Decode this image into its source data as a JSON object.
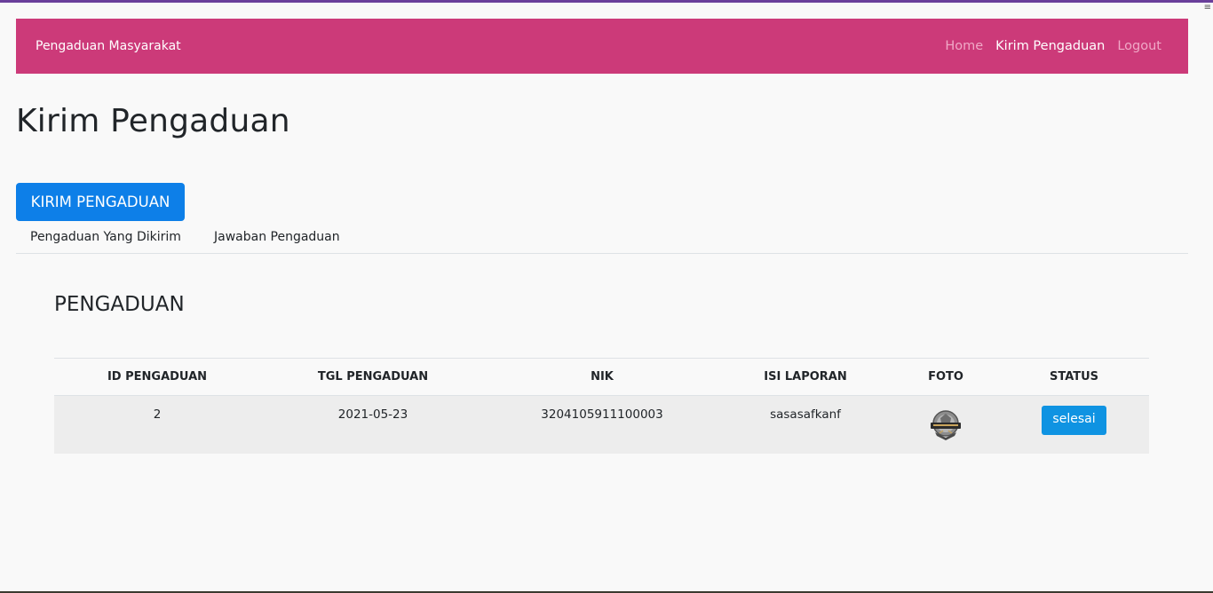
{
  "navbar": {
    "brand": "Pengaduan Masyarakat",
    "links": [
      {
        "label": "Home",
        "active": false
      },
      {
        "label": "Kirim Pengaduan",
        "active": true
      },
      {
        "label": "Logout",
        "active": false
      }
    ]
  },
  "page": {
    "title": "Kirim Pengaduan",
    "button_label": "KIRIM PENGADUAN",
    "tabs": [
      "Pengaduan Yang Dikirim",
      "Jawaban Pengaduan"
    ]
  },
  "section": {
    "title": "PENGADUAN"
  },
  "table": {
    "headers": [
      "ID PENGADUAN",
      "TGL PENGADUAN",
      "NIK",
      "ISI LAPORAN",
      "FOTO",
      "STATUS"
    ],
    "rows": [
      {
        "id": "2",
        "tgl": "2021-05-23",
        "nik": "3204105911100003",
        "isi": "sasasafkanf",
        "foto": "badge-image",
        "status": "selesai"
      }
    ]
  },
  "colors": {
    "navbar": "#cc3a79",
    "primary_button": "#0d7fe8",
    "status_badge": "#0f93e2"
  }
}
